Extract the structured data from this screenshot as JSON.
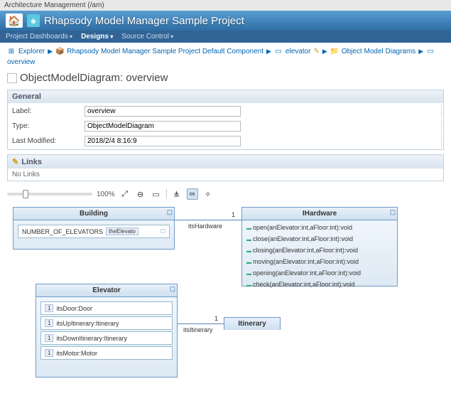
{
  "topbar": "Architecture Management (/am)",
  "banner": {
    "title": "Rhapsody Model Manager Sample Project"
  },
  "nav": {
    "dashboards": "Project Dashboards",
    "designs": "Designs",
    "source": "Source Control"
  },
  "breadcrumb": {
    "explorer": "Explorer",
    "component": "Rhapsody Model Manager Sample Project Default Component",
    "elevator": "elevator",
    "omd": "Object Model Diagrams",
    "overview": "overview"
  },
  "page": {
    "title": "ObjectModelDiagram: overview"
  },
  "general": {
    "header": "General",
    "labels": {
      "label": "Label:",
      "type": "Type:",
      "modified": "Last Modified:"
    },
    "values": {
      "label": "overview",
      "type": "ObjectModelDiagram",
      "modified": "2018/2/4 8:16:9"
    }
  },
  "links": {
    "header": "Links",
    "empty": "No Links"
  },
  "toolbar": {
    "zoom_pct": "100%"
  },
  "diagram": {
    "building": {
      "title": "Building",
      "attr": "NUMBER_OF_ELEVATORS",
      "part": "theElevato"
    },
    "hardware": {
      "title": "IHardware",
      "ops": [
        "open(anElevator:int,aFloor:int):void",
        "close(anElevator:int,aFloor:int):void",
        "closing(anElevator:int,aFloor:int):void",
        "moving(anElevator:int,aFloor:int):void",
        "opening(anElevator:int,aFloor:int):void",
        "check(anElevator:int,aFloor:int):void"
      ]
    },
    "elevator": {
      "title": "Elevator",
      "parts": [
        "itsDoor:Door",
        "itsUpItinerary:Itinerary",
        "itsDownItinerary:Itinerary",
        "itsMotor:Motor"
      ]
    },
    "itinerary": {
      "title": "Itinerary"
    },
    "conn": {
      "hw_label": "itsHardware",
      "hw_mult": "1",
      "it_label": "itsItinerary",
      "it_mult": "1",
      "one": "1"
    }
  }
}
